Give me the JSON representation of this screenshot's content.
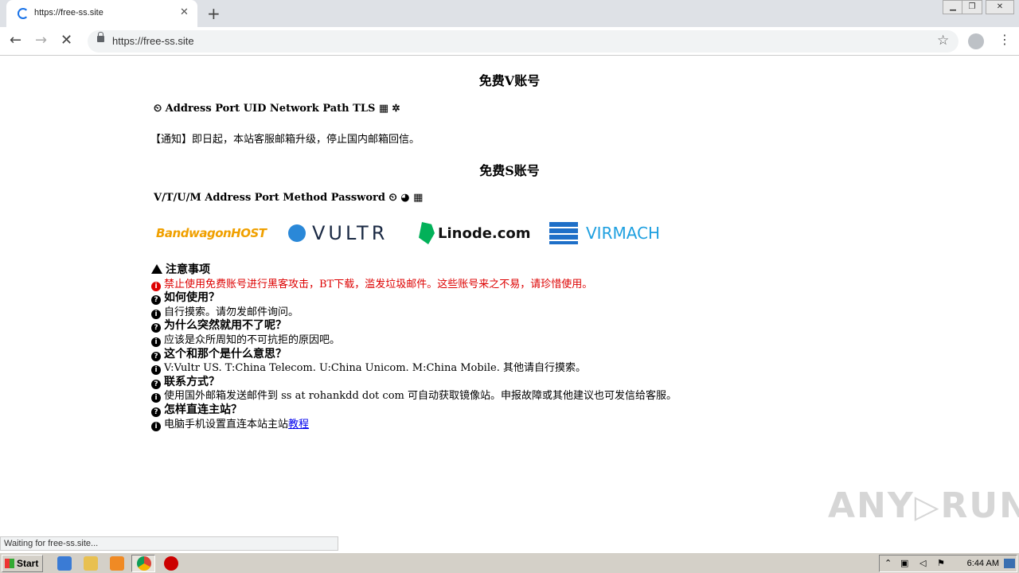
{
  "browser": {
    "tab_title": "https://free-ss.site",
    "url": "https://free-ss.site",
    "status_text": "Waiting for free-ss.site..."
  },
  "page": {
    "heading_v": "免费V账号",
    "v_columns": "Address Port UID Network Path TLS",
    "notice": "【通知】即日起，本站客服邮箱升级，停止国内邮箱回信。",
    "heading_s": "免费S账号",
    "s_columns": "V/T/U/M Address Port Method Password",
    "logos": [
      "BandwagonHOST",
      "VULTR",
      "Linode.com",
      "VIRMACH"
    ],
    "faq": {
      "attention_title": "注意事项",
      "attention_text": "禁止使用免费账号进行黑客攻击，BT下载，滥发垃圾邮件。这些账号来之不易，请珍惜使用。",
      "q1": "如何使用？",
      "a1": "自行摸索。请勿发邮件询问。",
      "q2": "为什么突然就用不了呢？",
      "a2": "应该是众所周知的不可抗拒的原因吧。",
      "q3": "这个和那个是什么意思？",
      "a3": "V:Vultr US. T:China Telecom. U:China Unicom. M:China Mobile. 其他请自行摸索。",
      "q4": "联系方式？",
      "a4": "使用国外邮箱发送邮件到 ss at rohankdd dot com 可自动获取镜像站。申报故障或其他建议也可发信给客服。",
      "q5": "怎样直连主站？",
      "a5": "电脑手机设置直连本站主站",
      "a5_link": "教程"
    }
  },
  "taskbar": {
    "start_label": "Start",
    "clock": "6:44 AM"
  },
  "watermark": "ANY RUN"
}
